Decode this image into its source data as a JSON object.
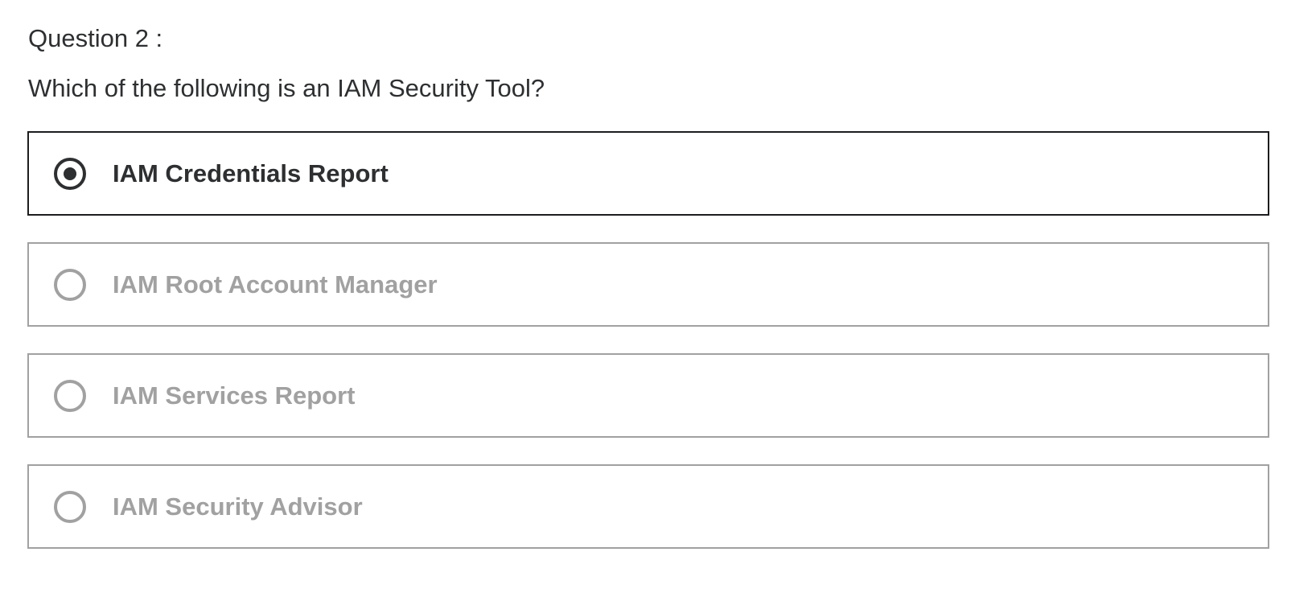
{
  "question": {
    "number_label": "Question 2 :",
    "text": "Which of the following is an IAM Security Tool?"
  },
  "options": [
    {
      "label": "IAM Credentials Report",
      "selected": true
    },
    {
      "label": "IAM Root Account Manager",
      "selected": false
    },
    {
      "label": "IAM Services Report",
      "selected": false
    },
    {
      "label": "IAM Security Advisor",
      "selected": false
    }
  ],
  "colors": {
    "text_primary": "#2d2f31",
    "text_muted": "#a1a1a1",
    "border_selected": "#1c1d1f",
    "border_default": "#a1a1a1"
  }
}
